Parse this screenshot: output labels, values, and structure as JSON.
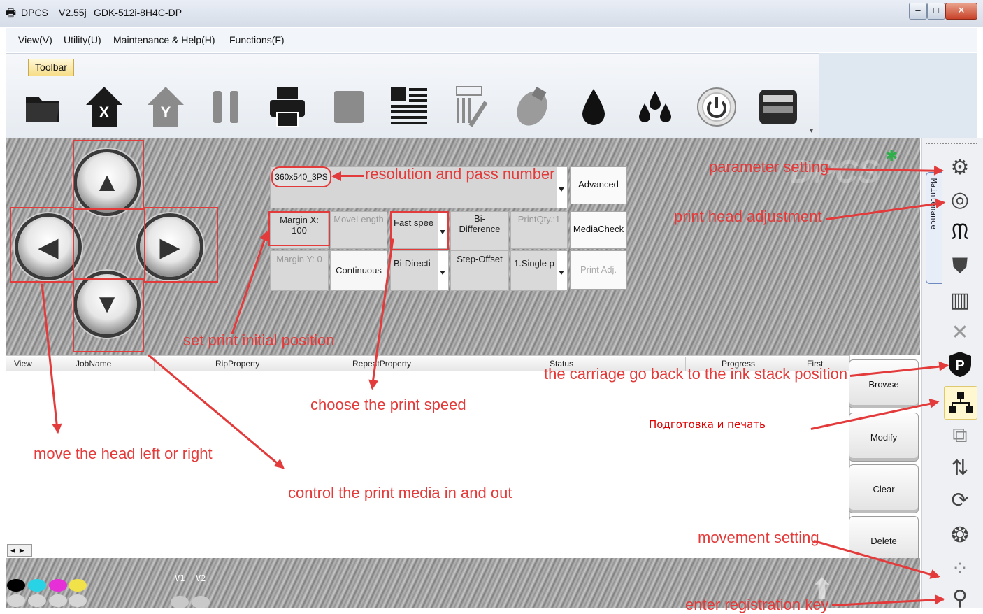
{
  "window": {
    "app": "DPCS",
    "version": "V2.55j",
    "model": "GDK-512i-8H4C-DP",
    "controls": [
      "–",
      "□",
      "✕"
    ]
  },
  "menu": [
    "View(V)",
    "Utility(U)",
    "Maintenance & Help(H)",
    "Functions(F)"
  ],
  "toolbar": {
    "tab_label": "Toolbar",
    "icons": [
      "folder-icon",
      "home-x-icon",
      "home-y-icon",
      "pause-icon",
      "printer-icon",
      "stop-icon",
      "print-list-icon",
      "print-check-icon",
      "clean-icon",
      "ink-drop-icon",
      "ink-drops-icon",
      "power-icon",
      "panel-icon"
    ]
  },
  "direction_pad": {
    "up": "▲",
    "left": "◀",
    "right": "▶",
    "down": "▼"
  },
  "controls": {
    "resolution": "360x540_3PS",
    "advanced": "Advanced",
    "margin_x_label": "Margin X:",
    "margin_x_value": "100",
    "move_length": "MoveLength",
    "speed": "Fast spee",
    "bi_difference": "Bi-\nDifference",
    "print_qty": "PrintQty.:1",
    "media_check": "MediaCheck",
    "margin_y": "Margin Y: 0",
    "continuous": "Continuous",
    "bi_direction": "Bi-Directi",
    "step_offset": "Step-Offset",
    "single_pass": "1.Single p",
    "print_adj": "Print Adj."
  },
  "logo": "DPCS",
  "table": {
    "headers": [
      "View",
      "JobName",
      "RipProperty",
      "RepeatProperty",
      "Status",
      "Progress",
      "First"
    ]
  },
  "side_buttons": [
    "Browse",
    "Modify",
    "Clear",
    "Delete"
  ],
  "maintenance_tab": "Maintenance",
  "right_icons": [
    "gear-icon",
    "target-icon",
    "carriage-icon",
    "shield-icon",
    "adjust-icon",
    "tools-icon",
    "parking-icon",
    "network-icon",
    "layers-icon",
    "swap-icon",
    "refresh-icon",
    "movement-gear-icon",
    "heads-icon",
    "search-icon"
  ],
  "bottom": {
    "v1": "V1",
    "v2": "V2",
    "ink_colors": [
      "#000000",
      "#29d3e6",
      "#e62fd6",
      "#f2e24a"
    ]
  },
  "annotations": {
    "resolution": "resolution and pass number",
    "parameter": "parameter setting",
    "head_adjust": "print head adjustment",
    "initial_position": "set print initial position",
    "carriage_back": "the carriage go back to the ink stack position",
    "print_speed": "choose the print speed",
    "head_move": "move the head left or right",
    "media": "control the print media in and out",
    "prepare_print": "Подготовка и печать",
    "movement": "movement setting",
    "registration": "enter registration key"
  }
}
